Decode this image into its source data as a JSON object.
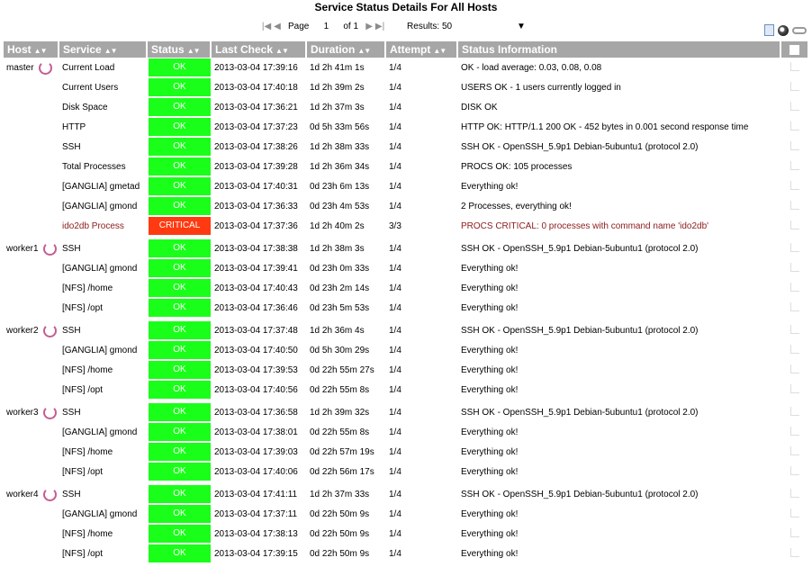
{
  "page": {
    "title": "Service Status Details For All Hosts"
  },
  "pager": {
    "page_label": "Page",
    "page_number": "1",
    "of_label": "of 1",
    "results_label": "Results: 50",
    "first_icon": "first-page-icon",
    "prev_icon": "prev-page-icon",
    "next_icon": "next-page-icon",
    "last_icon": "last-page-icon"
  },
  "colors": {
    "header_bg": "#a6a6a6",
    "ok_bg": "#19ff19",
    "critical_bg": "#ff3a10",
    "critical_text": "#8b1a1a"
  },
  "columns": {
    "host": "Host",
    "service": "Service",
    "status": "Status",
    "last_check": "Last Check",
    "duration": "Duration",
    "attempt": "Attempt",
    "status_information": "Status Information"
  },
  "groups": [
    {
      "host": "master",
      "rows": [
        {
          "service": "Current Load",
          "status": "OK",
          "last_check": "2013-03-04 17:39:16",
          "duration": "1d 2h 41m 1s",
          "attempt": "1/4",
          "info": "OK - load average: 0.03, 0.08, 0.08"
        },
        {
          "service": "Current Users",
          "status": "OK",
          "last_check": "2013-03-04 17:40:18",
          "duration": "1d 2h 39m 2s",
          "attempt": "1/4",
          "info": "USERS OK - 1 users currently logged in"
        },
        {
          "service": "Disk Space",
          "status": "OK",
          "last_check": "2013-03-04 17:36:21",
          "duration": "1d 2h 37m 3s",
          "attempt": "1/4",
          "info": "DISK OK"
        },
        {
          "service": "HTTP",
          "status": "OK",
          "last_check": "2013-03-04 17:37:23",
          "duration": "0d 5h 33m 56s",
          "attempt": "1/4",
          "info": "HTTP OK: HTTP/1.1 200 OK - 452 bytes in 0.001 second response time"
        },
        {
          "service": "SSH",
          "status": "OK",
          "last_check": "2013-03-04 17:38:26",
          "duration": "1d 2h 38m 33s",
          "attempt": "1/4",
          "info": "SSH OK - OpenSSH_5.9p1 Debian-5ubuntu1 (protocol 2.0)"
        },
        {
          "service": "Total Processes",
          "status": "OK",
          "last_check": "2013-03-04 17:39:28",
          "duration": "1d 2h 36m 34s",
          "attempt": "1/4",
          "info": "PROCS OK: 105 processes"
        },
        {
          "service": "[GANGLIA] gmetad",
          "status": "OK",
          "last_check": "2013-03-04 17:40:31",
          "duration": "0d 23h 6m 13s",
          "attempt": "1/4",
          "info": "Everything ok!"
        },
        {
          "service": "[GANGLIA] gmond",
          "status": "OK",
          "last_check": "2013-03-04 17:36:33",
          "duration": "0d 23h 4m 53s",
          "attempt": "1/4",
          "info": "2 Processes, everything ok!"
        },
        {
          "service": "ido2db Process",
          "status": "CRITICAL",
          "last_check": "2013-03-04 17:37:36",
          "duration": "1d 2h 40m 2s",
          "attempt": "3/3",
          "info": "PROCS CRITICAL: 0 processes with command name 'ido2db'"
        }
      ]
    },
    {
      "host": "worker1",
      "rows": [
        {
          "service": "SSH",
          "status": "OK",
          "last_check": "2013-03-04 17:38:38",
          "duration": "1d 2h 38m 3s",
          "attempt": "1/4",
          "info": "SSH OK - OpenSSH_5.9p1 Debian-5ubuntu1 (protocol 2.0)"
        },
        {
          "service": "[GANGLIA] gmond",
          "status": "OK",
          "last_check": "2013-03-04 17:39:41",
          "duration": "0d 23h 0m 33s",
          "attempt": "1/4",
          "info": "Everything ok!"
        },
        {
          "service": "[NFS] /home",
          "status": "OK",
          "last_check": "2013-03-04 17:40:43",
          "duration": "0d 23h 2m 14s",
          "attempt": "1/4",
          "info": "Everything ok!"
        },
        {
          "service": "[NFS] /opt",
          "status": "OK",
          "last_check": "2013-03-04 17:36:46",
          "duration": "0d 23h 5m 53s",
          "attempt": "1/4",
          "info": "Everything ok!"
        }
      ]
    },
    {
      "host": "worker2",
      "rows": [
        {
          "service": "SSH",
          "status": "OK",
          "last_check": "2013-03-04 17:37:48",
          "duration": "1d 2h 36m 4s",
          "attempt": "1/4",
          "info": "SSH OK - OpenSSH_5.9p1 Debian-5ubuntu1 (protocol 2.0)"
        },
        {
          "service": "[GANGLIA] gmond",
          "status": "OK",
          "last_check": "2013-03-04 17:40:50",
          "duration": "0d 5h 30m 29s",
          "attempt": "1/4",
          "info": "Everything ok!"
        },
        {
          "service": "[NFS] /home",
          "status": "OK",
          "last_check": "2013-03-04 17:39:53",
          "duration": "0d 22h 55m 27s",
          "attempt": "1/4",
          "info": "Everything ok!"
        },
        {
          "service": "[NFS] /opt",
          "status": "OK",
          "last_check": "2013-03-04 17:40:56",
          "duration": "0d 22h 55m 8s",
          "attempt": "1/4",
          "info": "Everything ok!"
        }
      ]
    },
    {
      "host": "worker3",
      "rows": [
        {
          "service": "SSH",
          "status": "OK",
          "last_check": "2013-03-04 17:36:58",
          "duration": "1d 2h 39m 32s",
          "attempt": "1/4",
          "info": "SSH OK - OpenSSH_5.9p1 Debian-5ubuntu1 (protocol 2.0)"
        },
        {
          "service": "[GANGLIA] gmond",
          "status": "OK",
          "last_check": "2013-03-04 17:38:01",
          "duration": "0d 22h 55m 8s",
          "attempt": "1/4",
          "info": "Everything ok!"
        },
        {
          "service": "[NFS] /home",
          "status": "OK",
          "last_check": "2013-03-04 17:39:03",
          "duration": "0d 22h 57m 19s",
          "attempt": "1/4",
          "info": "Everything ok!"
        },
        {
          "service": "[NFS] /opt",
          "status": "OK",
          "last_check": "2013-03-04 17:40:06",
          "duration": "0d 22h 56m 17s",
          "attempt": "1/4",
          "info": "Everything ok!"
        }
      ]
    },
    {
      "host": "worker4",
      "rows": [
        {
          "service": "SSH",
          "status": "OK",
          "last_check": "2013-03-04 17:41:11",
          "duration": "1d 2h 37m 33s",
          "attempt": "1/4",
          "info": "SSH OK - OpenSSH_5.9p1 Debian-5ubuntu1 (protocol 2.0)"
        },
        {
          "service": "[GANGLIA] gmond",
          "status": "OK",
          "last_check": "2013-03-04 17:37:11",
          "duration": "0d 22h 50m 9s",
          "attempt": "1/4",
          "info": "Everything ok!"
        },
        {
          "service": "[NFS] /home",
          "status": "OK",
          "last_check": "2013-03-04 17:38:13",
          "duration": "0d 22h 50m 9s",
          "attempt": "1/4",
          "info": "Everything ok!"
        },
        {
          "service": "[NFS] /opt",
          "status": "OK",
          "last_check": "2013-03-04 17:39:15",
          "duration": "0d 22h 50m 9s",
          "attempt": "1/4",
          "info": "Everything ok!"
        }
      ]
    }
  ]
}
